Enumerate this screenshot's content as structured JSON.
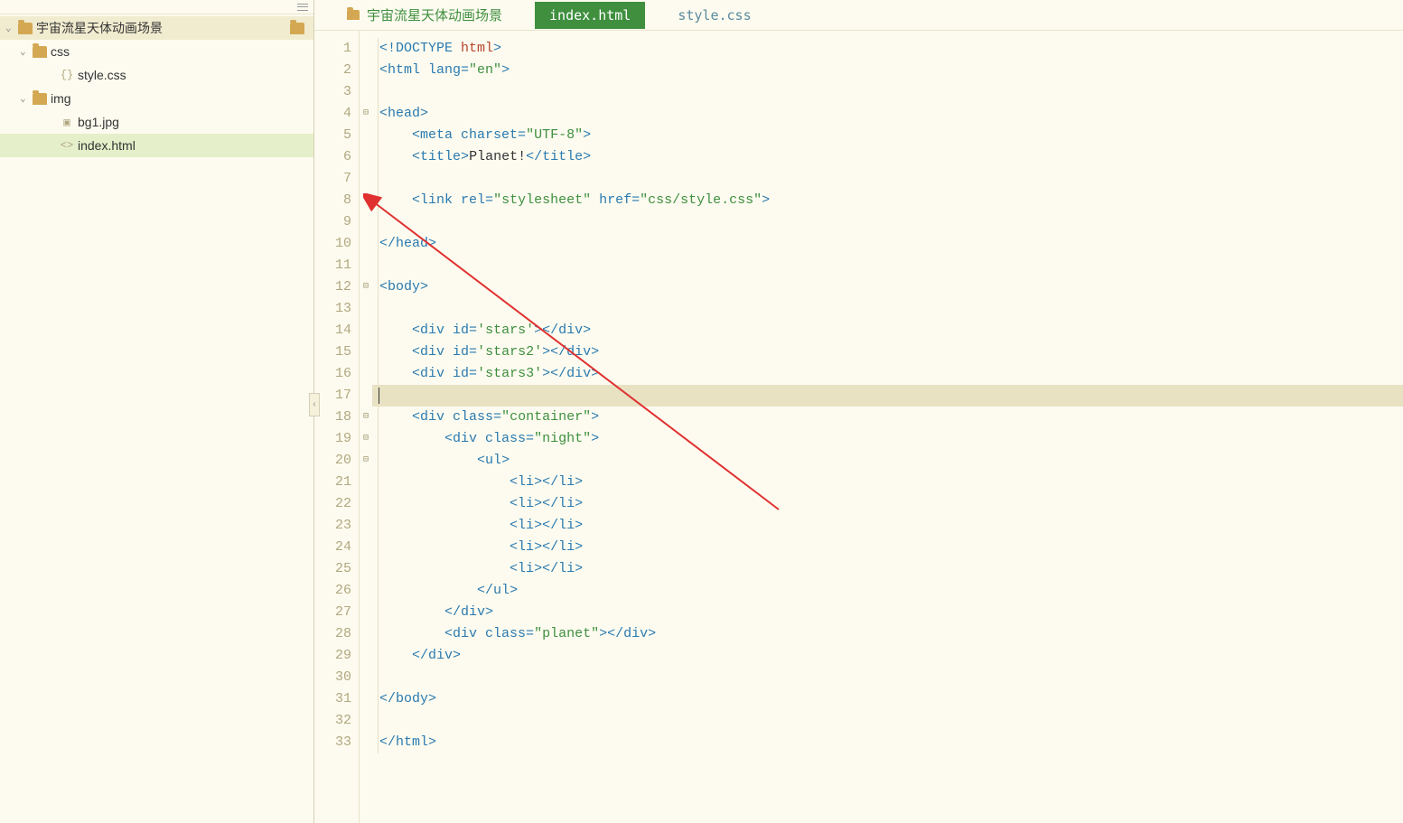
{
  "sidebar": {
    "root": "宇宙流星天体动画场景",
    "items": [
      {
        "label": "css",
        "type": "folder",
        "level": 1
      },
      {
        "label": "style.css",
        "type": "css-file",
        "level": 2
      },
      {
        "label": "img",
        "type": "folder",
        "level": 1
      },
      {
        "label": "bg1.jpg",
        "type": "image-file",
        "level": 2
      },
      {
        "label": "index.html",
        "type": "html-file",
        "level": 2,
        "selected": true
      }
    ]
  },
  "tabs": {
    "breadcrumb": "宇宙流星天体动画场景",
    "active": "index.html",
    "inactive": "style.css"
  },
  "code": {
    "lines": [
      {
        "n": "1",
        "fold": "",
        "tokens": [
          {
            "c": "t-punct",
            "t": "<!"
          },
          {
            "c": "t-doctype",
            "t": "DOCTYPE "
          },
          {
            "c": "t-doctype-kw",
            "t": "html"
          },
          {
            "c": "t-punct",
            "t": ">"
          }
        ]
      },
      {
        "n": "2",
        "fold": "",
        "tokens": [
          {
            "c": "t-punct",
            "t": "<"
          },
          {
            "c": "t-tag",
            "t": "html "
          },
          {
            "c": "t-attr",
            "t": "lang="
          },
          {
            "c": "t-string",
            "t": "\"en\""
          },
          {
            "c": "t-punct",
            "t": ">"
          }
        ]
      },
      {
        "n": "3",
        "fold": "",
        "tokens": []
      },
      {
        "n": "4",
        "fold": "⊟",
        "tokens": [
          {
            "c": "t-punct",
            "t": "<"
          },
          {
            "c": "t-tag",
            "t": "head"
          },
          {
            "c": "t-punct",
            "t": ">"
          }
        ]
      },
      {
        "n": "5",
        "fold": "",
        "indent": "    ",
        "tokens": [
          {
            "c": "t-punct",
            "t": "<"
          },
          {
            "c": "t-tag",
            "t": "meta "
          },
          {
            "c": "t-attr",
            "t": "charset="
          },
          {
            "c": "t-string",
            "t": "\"UTF-8\""
          },
          {
            "c": "t-punct",
            "t": ">"
          }
        ]
      },
      {
        "n": "6",
        "fold": "",
        "indent": "    ",
        "tokens": [
          {
            "c": "t-punct",
            "t": "<"
          },
          {
            "c": "t-tag",
            "t": "title"
          },
          {
            "c": "t-punct",
            "t": ">"
          },
          {
            "c": "t-text",
            "t": "Planet!"
          },
          {
            "c": "t-punct",
            "t": "</"
          },
          {
            "c": "t-tag",
            "t": "title"
          },
          {
            "c": "t-punct",
            "t": ">"
          }
        ]
      },
      {
        "n": "7",
        "fold": "",
        "tokens": []
      },
      {
        "n": "8",
        "fold": "",
        "indent": "    ",
        "tokens": [
          {
            "c": "t-punct",
            "t": "<"
          },
          {
            "c": "t-tag",
            "t": "link "
          },
          {
            "c": "t-attr",
            "t": "rel="
          },
          {
            "c": "t-string",
            "t": "\"stylesheet\""
          },
          {
            "c": "t-attr",
            "t": " href="
          },
          {
            "c": "t-string",
            "t": "\"css/style.css\""
          },
          {
            "c": "t-punct",
            "t": ">"
          }
        ]
      },
      {
        "n": "9",
        "fold": "",
        "tokens": []
      },
      {
        "n": "10",
        "fold": "",
        "tokens": [
          {
            "c": "t-punct",
            "t": "</"
          },
          {
            "c": "t-tag",
            "t": "head"
          },
          {
            "c": "t-punct",
            "t": ">"
          }
        ]
      },
      {
        "n": "11",
        "fold": "",
        "tokens": []
      },
      {
        "n": "12",
        "fold": "⊟",
        "tokens": [
          {
            "c": "t-punct",
            "t": "<"
          },
          {
            "c": "t-tag",
            "t": "body"
          },
          {
            "c": "t-punct",
            "t": ">"
          }
        ]
      },
      {
        "n": "13",
        "fold": "",
        "tokens": []
      },
      {
        "n": "14",
        "fold": "",
        "indent": "    ",
        "tokens": [
          {
            "c": "t-punct",
            "t": "<"
          },
          {
            "c": "t-tag",
            "t": "div "
          },
          {
            "c": "t-attr",
            "t": "id="
          },
          {
            "c": "t-string",
            "t": "'stars'"
          },
          {
            "c": "t-punct",
            "t": "></"
          },
          {
            "c": "t-tag",
            "t": "div"
          },
          {
            "c": "t-punct",
            "t": ">"
          }
        ]
      },
      {
        "n": "15",
        "fold": "",
        "indent": "    ",
        "tokens": [
          {
            "c": "t-punct",
            "t": "<"
          },
          {
            "c": "t-tag",
            "t": "div "
          },
          {
            "c": "t-attr",
            "t": "id="
          },
          {
            "c": "t-string",
            "t": "'stars2'"
          },
          {
            "c": "t-punct",
            "t": "></"
          },
          {
            "c": "t-tag",
            "t": "div"
          },
          {
            "c": "t-punct",
            "t": ">"
          }
        ]
      },
      {
        "n": "16",
        "fold": "",
        "indent": "    ",
        "tokens": [
          {
            "c": "t-punct",
            "t": "<"
          },
          {
            "c": "t-tag",
            "t": "div "
          },
          {
            "c": "t-attr",
            "t": "id="
          },
          {
            "c": "t-string",
            "t": "'stars3'"
          },
          {
            "c": "t-punct",
            "t": "></"
          },
          {
            "c": "t-tag",
            "t": "div"
          },
          {
            "c": "t-punct",
            "t": ">"
          }
        ]
      },
      {
        "n": "17",
        "fold": "",
        "current": true,
        "tokens": []
      },
      {
        "n": "18",
        "fold": "⊟",
        "indent": "    ",
        "tokens": [
          {
            "c": "t-punct",
            "t": "<"
          },
          {
            "c": "t-tag",
            "t": "div "
          },
          {
            "c": "t-attr",
            "t": "class="
          },
          {
            "c": "t-string",
            "t": "\"container\""
          },
          {
            "c": "t-punct",
            "t": ">"
          }
        ]
      },
      {
        "n": "19",
        "fold": "⊟",
        "indent": "        ",
        "tokens": [
          {
            "c": "t-punct",
            "t": "<"
          },
          {
            "c": "t-tag",
            "t": "div "
          },
          {
            "c": "t-attr",
            "t": "class="
          },
          {
            "c": "t-string",
            "t": "\"night\""
          },
          {
            "c": "t-punct",
            "t": ">"
          }
        ]
      },
      {
        "n": "20",
        "fold": "⊟",
        "indent": "            ",
        "tokens": [
          {
            "c": "t-punct",
            "t": "<"
          },
          {
            "c": "t-tag",
            "t": "ul"
          },
          {
            "c": "t-punct",
            "t": ">"
          }
        ]
      },
      {
        "n": "21",
        "fold": "",
        "indent": "                ",
        "tokens": [
          {
            "c": "t-punct",
            "t": "<"
          },
          {
            "c": "t-tag",
            "t": "li"
          },
          {
            "c": "t-punct",
            "t": "></"
          },
          {
            "c": "t-tag",
            "t": "li"
          },
          {
            "c": "t-punct",
            "t": ">"
          }
        ]
      },
      {
        "n": "22",
        "fold": "",
        "indent": "                ",
        "tokens": [
          {
            "c": "t-punct",
            "t": "<"
          },
          {
            "c": "t-tag",
            "t": "li"
          },
          {
            "c": "t-punct",
            "t": "></"
          },
          {
            "c": "t-tag",
            "t": "li"
          },
          {
            "c": "t-punct",
            "t": ">"
          }
        ]
      },
      {
        "n": "23",
        "fold": "",
        "indent": "                ",
        "tokens": [
          {
            "c": "t-punct",
            "t": "<"
          },
          {
            "c": "t-tag",
            "t": "li"
          },
          {
            "c": "t-punct",
            "t": "></"
          },
          {
            "c": "t-tag",
            "t": "li"
          },
          {
            "c": "t-punct",
            "t": ">"
          }
        ]
      },
      {
        "n": "24",
        "fold": "",
        "indent": "                ",
        "tokens": [
          {
            "c": "t-punct",
            "t": "<"
          },
          {
            "c": "t-tag",
            "t": "li"
          },
          {
            "c": "t-punct",
            "t": "></"
          },
          {
            "c": "t-tag",
            "t": "li"
          },
          {
            "c": "t-punct",
            "t": ">"
          }
        ]
      },
      {
        "n": "25",
        "fold": "",
        "indent": "                ",
        "tokens": [
          {
            "c": "t-punct",
            "t": "<"
          },
          {
            "c": "t-tag",
            "t": "li"
          },
          {
            "c": "t-punct",
            "t": "></"
          },
          {
            "c": "t-tag",
            "t": "li"
          },
          {
            "c": "t-punct",
            "t": ">"
          }
        ]
      },
      {
        "n": "26",
        "fold": "",
        "indent": "            ",
        "tokens": [
          {
            "c": "t-punct",
            "t": "</"
          },
          {
            "c": "t-tag",
            "t": "ul"
          },
          {
            "c": "t-punct",
            "t": ">"
          }
        ]
      },
      {
        "n": "27",
        "fold": "",
        "indent": "        ",
        "tokens": [
          {
            "c": "t-punct",
            "t": "</"
          },
          {
            "c": "t-tag",
            "t": "div"
          },
          {
            "c": "t-punct",
            "t": ">"
          }
        ]
      },
      {
        "n": "28",
        "fold": "",
        "indent": "        ",
        "tokens": [
          {
            "c": "t-punct",
            "t": "<"
          },
          {
            "c": "t-tag",
            "t": "div "
          },
          {
            "c": "t-attr",
            "t": "class="
          },
          {
            "c": "t-string",
            "t": "\"planet\""
          },
          {
            "c": "t-punct",
            "t": "></"
          },
          {
            "c": "t-tag",
            "t": "div"
          },
          {
            "c": "t-punct",
            "t": ">"
          }
        ]
      },
      {
        "n": "29",
        "fold": "",
        "indent": "    ",
        "tokens": [
          {
            "c": "t-punct",
            "t": "</"
          },
          {
            "c": "t-tag",
            "t": "div"
          },
          {
            "c": "t-punct",
            "t": ">"
          }
        ]
      },
      {
        "n": "30",
        "fold": "",
        "tokens": []
      },
      {
        "n": "31",
        "fold": "",
        "tokens": [
          {
            "c": "t-punct",
            "t": "</"
          },
          {
            "c": "t-tag",
            "t": "body"
          },
          {
            "c": "t-punct",
            "t": ">"
          }
        ]
      },
      {
        "n": "32",
        "fold": "",
        "tokens": []
      },
      {
        "n": "33",
        "fold": "",
        "tokens": [
          {
            "c": "t-punct",
            "t": "</"
          },
          {
            "c": "t-tag",
            "t": "html"
          },
          {
            "c": "t-punct",
            "t": ">"
          }
        ]
      }
    ]
  }
}
